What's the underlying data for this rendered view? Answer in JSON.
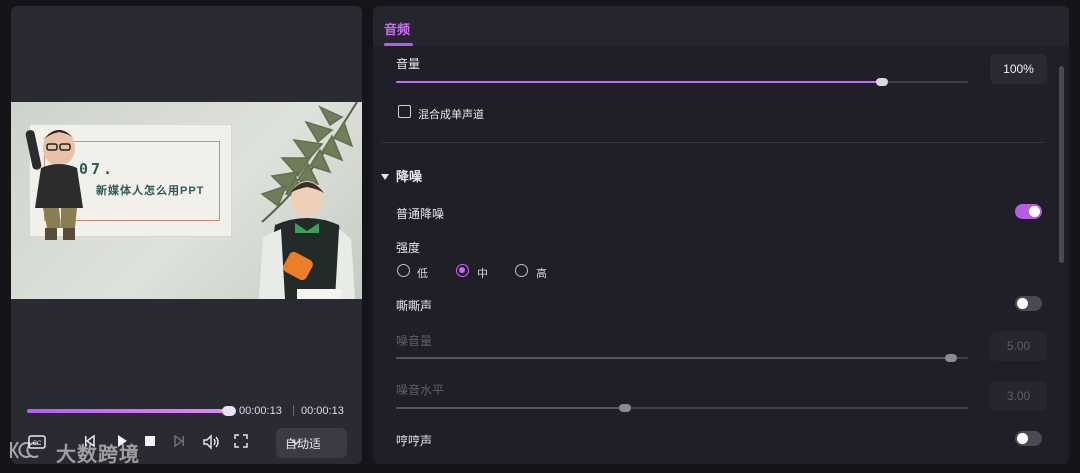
{
  "preview": {
    "slide_number": "07.",
    "slide_title": "新媒体人怎么用PPT",
    "progress": 0.97,
    "time_current": "00:00:13",
    "time_separator": "|",
    "time_total": "00:00:13",
    "auto_select_label": "自动适配"
  },
  "audio_panel": {
    "tab_label": "音频",
    "volume": {
      "label": "音量",
      "value": "100%",
      "fraction": 0.85
    },
    "mix_mono": {
      "label": "混合成单声道",
      "checked": false
    },
    "denoise": {
      "section_label": "降噪",
      "normal_denoise": {
        "label": "普通降噪",
        "enabled": true
      },
      "strength": {
        "label": "强度",
        "options": [
          "低",
          "中",
          "高"
        ],
        "selected": "中"
      },
      "hiss": {
        "label": "嘶嘶声",
        "enabled": false,
        "noise_volume": {
          "label": "噪音量",
          "value": "5.00",
          "fraction": 0.97
        },
        "noise_level": {
          "label": "噪音水平",
          "value": "3.00",
          "fraction": 0.4
        }
      },
      "hum": {
        "label": "哼哼声",
        "enabled": false
      }
    }
  },
  "watermark": {
    "text": "大数跨境"
  },
  "colors": {
    "accent": "#c46df2",
    "panel_bg": "#1f1f27",
    "preview_bg": "#2a2a33",
    "toggle_on": "#b45ee8",
    "toggle_off": "#4a4a55"
  },
  "icons": [
    "subtitle-icon",
    "prev-frame-icon",
    "play-icon",
    "stop-icon",
    "next-frame-icon",
    "volume-icon",
    "fullscreen-icon",
    "chevron-down-icon",
    "caret-down-icon"
  ]
}
